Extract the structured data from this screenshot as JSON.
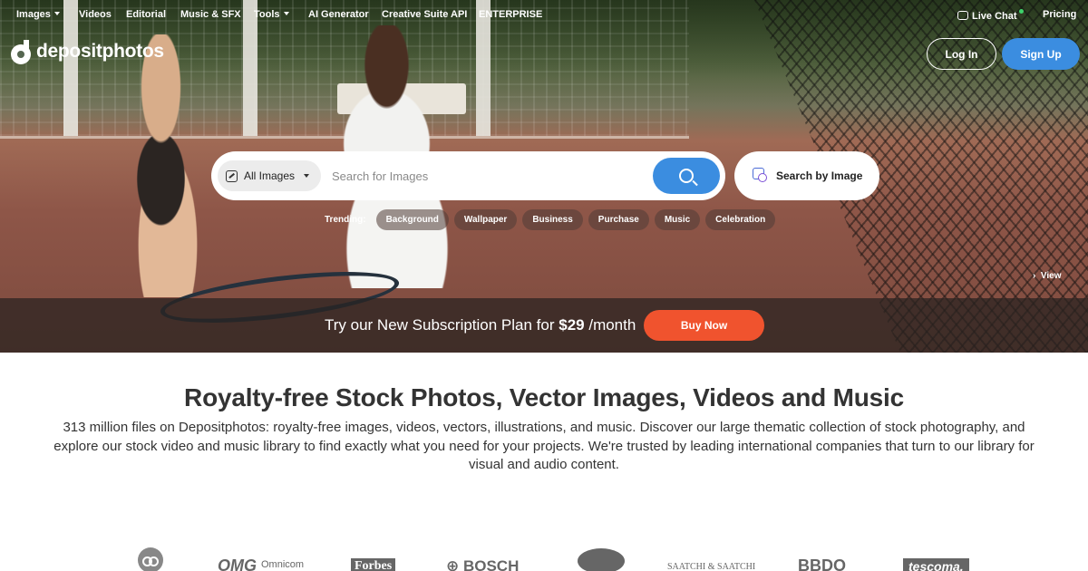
{
  "nav": {
    "images": "Images",
    "videos": "Videos",
    "editorial": "Editorial",
    "music": "Music & SFX",
    "tools": "Tools",
    "ai": "AI Generator",
    "api": "Creative Suite API",
    "enterprise": "ENTERPRISE",
    "live_chat": "Live Chat",
    "pricing": "Pricing"
  },
  "brand": {
    "logo_text": "depositphotos"
  },
  "auth": {
    "login": "Log In",
    "signup": "Sign Up"
  },
  "search": {
    "type_label": "All Images",
    "placeholder": "Search for Images",
    "by_image_label": "Search by Image"
  },
  "trending": {
    "label": "Trending:",
    "items": [
      "Background",
      "Wallpaper",
      "Business",
      "Purchase",
      "Music",
      "Celebration"
    ]
  },
  "hero": {
    "view_label": "View"
  },
  "promo": {
    "text_before": "Try our New Subscription Plan for ",
    "price": "$29",
    "text_after": " /month",
    "button": "Buy Now"
  },
  "content": {
    "heading": "Royalty-free Stock Photos, Vector Images, Videos and Music",
    "description": "313 million files on Depositphotos: royalty-free images, videos, vectors, illustrations, and music. Discover our large thematic collection of stock photography, and explore our stock video and music library to find exactly what you need for your projects. We're trusted by leading international companies that turn to our library for visual and audio content."
  },
  "partners": {
    "omnicom": "Omnicom",
    "forbes": "Forbes",
    "bosch": "BOSCH",
    "saatchi": "SAATCHI & SAATCHI",
    "bbdo": "BBDO",
    "tescoma": "tescoma."
  },
  "colors": {
    "accent_blue": "#3b8de0",
    "buy_orange": "#f0532e",
    "online_green": "#3ed36b"
  }
}
